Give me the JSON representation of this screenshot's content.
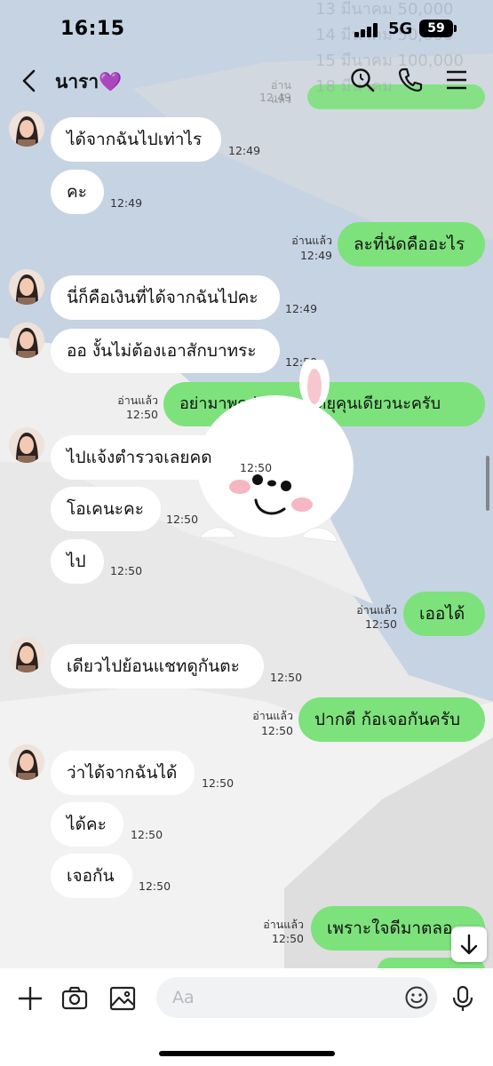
{
  "status_bar": {
    "time": "16:15",
    "network": "5G",
    "battery": "59"
  },
  "header": {
    "contact_name": "นารา💜",
    "back_icon": "chevron-left-icon",
    "search_icon": "search-icon",
    "call_icon": "phone-icon",
    "menu_icon": "hamburger-menu-icon"
  },
  "messages": [
    {
      "side": "in",
      "text": "ได้จากฉันไปเท่าไร",
      "time": "12:49",
      "avatar": true
    },
    {
      "side": "in",
      "text": "คะ",
      "time": "12:49",
      "avatar": false
    },
    {
      "side": "out",
      "text": "ละที่นัดคืออะไร",
      "read": "อ่านแล้ว",
      "time": "12:49"
    },
    {
      "side": "in",
      "text": "นี่ก็คือเงินที่ได้จากฉันไปคะ",
      "time": "12:49",
      "avatar": true
    },
    {
      "side": "in",
      "text": "ออ งั้นไม่ต้องเอาสักบาทระ",
      "time": "12:50",
      "avatar": true
    },
    {
      "side": "out",
      "text": "อย่ามาพูดว่าตัวเองได้ยุคุนเดียวนะครับ",
      "read": "อ่านแล้ว",
      "time": "12:50"
    },
    {
      "side": "in",
      "text": "ไปแจ้งตำรวจเลยคด",
      "time": "12:50",
      "avatar": true
    },
    {
      "side": "in",
      "text": "โอเคนะคะ",
      "time": "12:50",
      "avatar": false
    },
    {
      "side": "in",
      "text": "ไป",
      "time": "12:50",
      "avatar": false
    },
    {
      "side": "out",
      "text": "เออได้",
      "read": "อ่านแล้ว",
      "time": "12:50"
    },
    {
      "side": "in",
      "text": "เดียวไปย้อนแชทดูกันตะ",
      "time": "12:50",
      "avatar": true
    },
    {
      "side": "out",
      "text": "ปากดี ก้อเจอกันครับ",
      "read": "อ่านแล้ว",
      "time": "12:50"
    },
    {
      "side": "in",
      "text": "ว่าได้จากฉันได้",
      "time": "12:50",
      "avatar": true
    },
    {
      "side": "in",
      "text": "ได้คะ",
      "time": "12:50",
      "avatar": false
    },
    {
      "side": "in",
      "text": "เจอกัน",
      "time": "12:50",
      "avatar": false
    },
    {
      "side": "out",
      "text": "เพราะใจดีมาตลอ",
      "read": "อ่านแล้ว",
      "time": "12:50"
    }
  ],
  "top_partial": {
    "read": "อ่านแล้ว",
    "time": "12:49",
    "bg_text": [
      "13 มีนาคม 50,000",
      "14 มีนาคม 50,000",
      "15 มีนาคม 100,000",
      "18 มีนาคม"
    ]
  },
  "input_bar": {
    "placeholder": "Aa",
    "add_icon": "plus-icon",
    "camera_icon": "camera-icon",
    "image_icon": "image-icon",
    "emoji_icon": "emoji-icon",
    "mic_icon": "microphone-icon"
  },
  "colors": {
    "outgoing_bubble": "#7de27c",
    "incoming_bubble": "#ffffff",
    "background": "#c6d3e2"
  }
}
